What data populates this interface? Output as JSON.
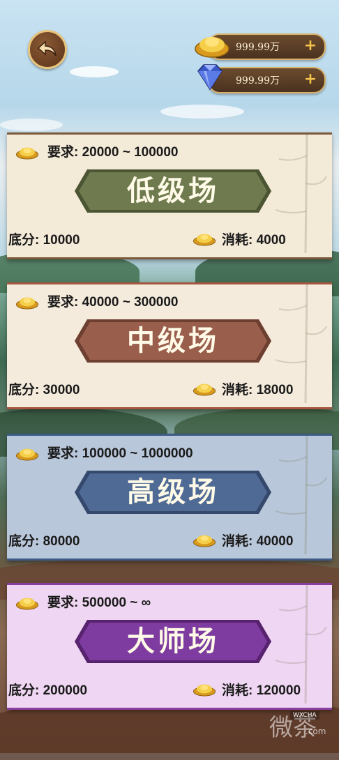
{
  "top": {
    "gold_value": "999.99万",
    "diamond_value": "999.99万",
    "plus_symbol": "+"
  },
  "rooms": [
    {
      "requirement": "要求: 20000 ~ 100000",
      "title": "低级场",
      "base_score": "底分: 10000",
      "cost": "消耗: 4000",
      "card_bg": "#f3ead8",
      "border": "#7a5a3a",
      "banner": "#6f7a4e",
      "banner_edge": "#4b5433"
    },
    {
      "requirement": "要求: 40000 ~ 300000",
      "title": "中级场",
      "base_score": "底分: 30000",
      "cost": "消耗: 18000",
      "card_bg": "#f5ebdc",
      "border": "#a6553f",
      "banner": "#9a5f4c",
      "banner_edge": "#6d3f31"
    },
    {
      "requirement": "要求: 100000 ~ 1000000",
      "title": "高级场",
      "base_score": "底分: 80000",
      "cost": "消耗: 40000",
      "card_bg": "#b9c7da",
      "border": "#3e5a86",
      "banner": "#4f6a94",
      "banner_edge": "#34496c"
    },
    {
      "requirement": "要求: 500000 ~ ∞",
      "title": "大师场",
      "base_score": "底分: 200000",
      "cost": "消耗: 120000",
      "card_bg": "#efd6f2",
      "border": "#8a3ea1",
      "banner": "#7e3ca0",
      "banner_edge": "#57236f"
    }
  ],
  "watermark": {
    "text": "微茶",
    "label": "WXCHA",
    "domain": ".com"
  },
  "icons": {
    "back": "back-arrow-icon",
    "gold": "gold-ingot-icon",
    "diamond": "diamond-icon",
    "plus": "plus-icon"
  }
}
